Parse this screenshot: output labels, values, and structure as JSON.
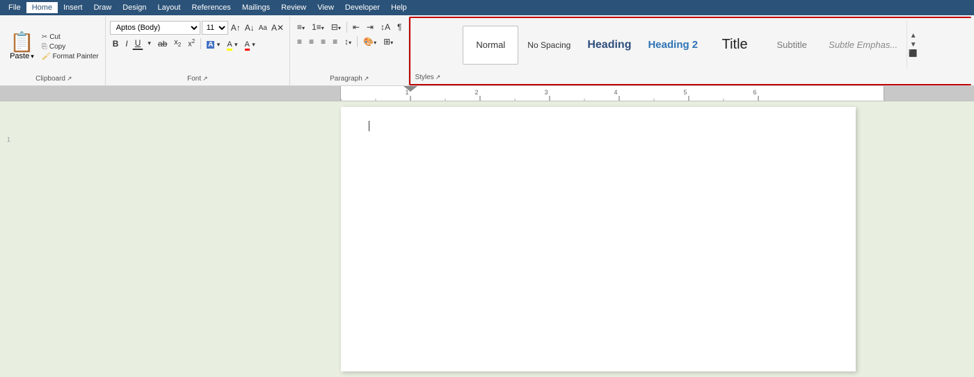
{
  "menubar": {
    "items": [
      "File",
      "Home",
      "Insert",
      "Draw",
      "Design",
      "Layout",
      "References",
      "Mailings",
      "Review",
      "View",
      "Developer",
      "Help"
    ],
    "active": "Home"
  },
  "ribbon": {
    "clipboard": {
      "label": "Clipboard",
      "paste_label": "Paste",
      "cut_label": "Cut",
      "copy_label": "Copy",
      "format_painter_label": "Format Painter"
    },
    "font": {
      "label": "Font",
      "font_name": "Aptos (Body)",
      "font_size": "11",
      "bold": "B",
      "italic": "I",
      "underline": "U",
      "strikethrough": "ab",
      "subscript": "x₂",
      "superscript": "x²"
    },
    "paragraph": {
      "label": "Paragraph"
    },
    "styles": {
      "label": "Styles",
      "items": [
        {
          "id": "normal",
          "label": "Normal",
          "active": true
        },
        {
          "id": "no-spacing",
          "label": "No Spacing",
          "active": false
        },
        {
          "id": "heading1",
          "label": "Heading",
          "active": false
        },
        {
          "id": "heading2",
          "label": "Heading 2",
          "active": false
        },
        {
          "id": "title",
          "label": "Title",
          "active": false
        },
        {
          "id": "subtitle",
          "label": "Subtitle",
          "active": false
        },
        {
          "id": "subtle-emphasis",
          "label": "Subtle Emphas...",
          "active": false
        }
      ]
    }
  },
  "document": {
    "content": ""
  }
}
